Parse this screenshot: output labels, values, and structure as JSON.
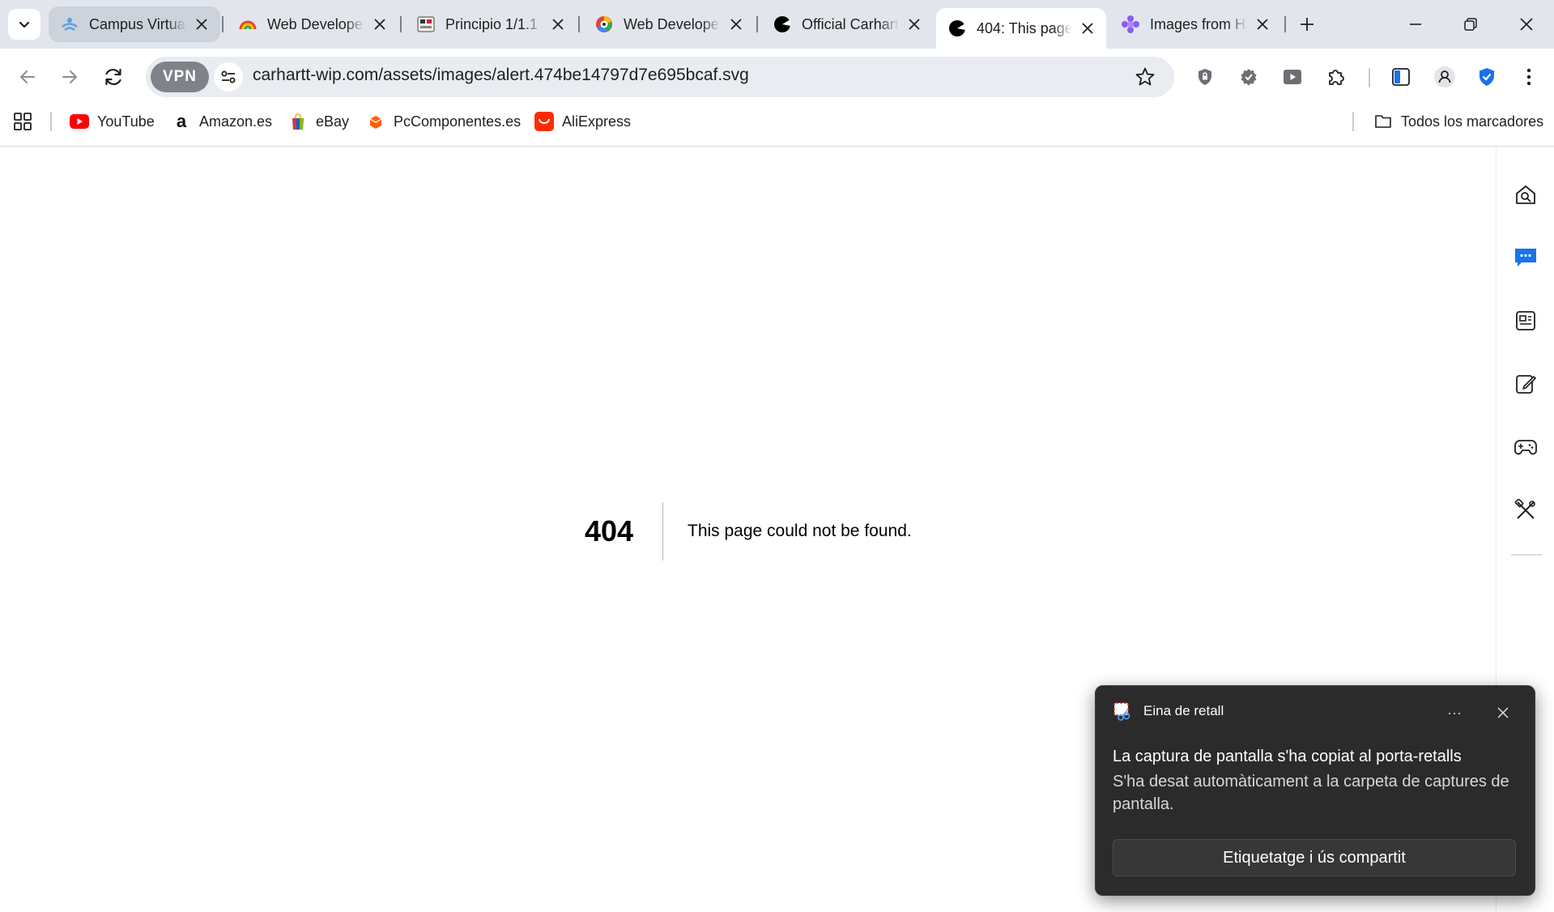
{
  "tabs": [
    {
      "title": "Campus Virtual",
      "favicon": "campus-virtual-icon",
      "state": "hover"
    },
    {
      "title": "Web Developer",
      "favicon": "rainbow-icon",
      "state": "normal"
    },
    {
      "title": "Principio 1/1.1",
      "favicon": "biocuantica-icon",
      "state": "normal"
    },
    {
      "title": "Web Developer",
      "favicon": "color-wheel-icon",
      "state": "normal"
    },
    {
      "title": "Official Carhartt",
      "favicon": "carhartt-icon",
      "state": "normal"
    },
    {
      "title": "404: This page",
      "favicon": "carhartt-icon",
      "state": "active"
    },
    {
      "title": "Images from H",
      "favicon": "puzzle-flower-icon",
      "state": "normal"
    }
  ],
  "address_bar": {
    "vpn_label": "VPN",
    "url": "carhartt-wip.com/assets/images/alert.474be14797d7e695bcaf.svg"
  },
  "bookmarks": [
    {
      "label": "YouTube",
      "icon": "youtube-icon"
    },
    {
      "label": "Amazon.es",
      "icon": "amazon-icon"
    },
    {
      "label": "eBay",
      "icon": "ebay-icon"
    },
    {
      "label": "PcComponentes.es",
      "icon": "pccomponentes-icon"
    },
    {
      "label": "AliExpress",
      "icon": "aliexpress-icon"
    }
  ],
  "all_bookmarks_label": "Todos los marcadores",
  "error_page": {
    "code": "404",
    "message": "This page could not be found."
  },
  "toast": {
    "app_name": "Eina de retall",
    "more": "···",
    "title": "La captura de pantalla s'ha copiat al porta-retalls",
    "body": "S'ha desat automàticament a la carpeta de captures de pantalla.",
    "button": "Etiquetatge i ús compartit"
  },
  "colors": {
    "tabstrip_bg": "#e2e6ec",
    "toast_bg": "#2b2b2b",
    "accent_blue": "#1a73e8"
  }
}
